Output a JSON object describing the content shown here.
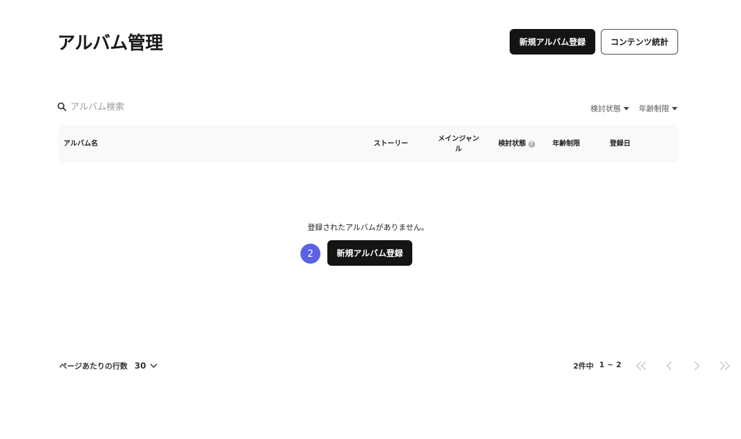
{
  "header": {
    "title": "アルバム管理",
    "new_album_label": "新規アルバム登録",
    "content_stats_label": "コンテンツ統計"
  },
  "search": {
    "placeholder": "アルバム検索"
  },
  "filters": [
    {
      "label": "検討状態"
    },
    {
      "label": "年齢制限"
    }
  ],
  "table": {
    "columns": {
      "album_name": "アルバム名",
      "story": "ストーリー",
      "main_genre": "メインジャンル",
      "review_status": "検討状態",
      "age_limit": "年齢制限",
      "registered_date": "登録日"
    }
  },
  "empty_state": {
    "message": "登録されたアルバムがありません。",
    "step_number": "2",
    "button_label": "新規アルバム登録"
  },
  "footer": {
    "rows_per_page_label": "ページあたりの行数",
    "rows_per_page_value": "30",
    "total_label": "2件中",
    "range_label": "1 ~ 2"
  },
  "colors": {
    "primary": "#141414",
    "accent": "#5b62e6",
    "header_bg": "#f9f9f9",
    "disabled": "#c8c8c8"
  }
}
